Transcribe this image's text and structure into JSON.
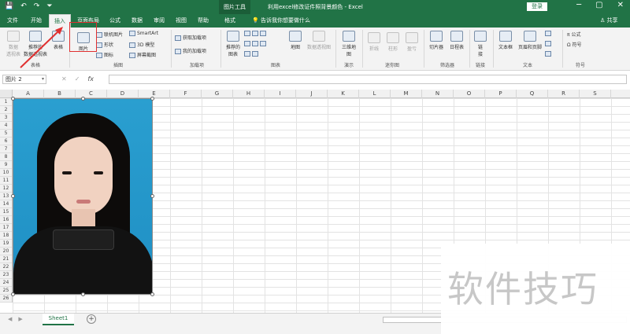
{
  "titlebar": {
    "qat": [
      "💾",
      "↶",
      "↷",
      "⏷"
    ],
    "picture_tools": "图片工具",
    "document_title": "利用excel修改证件照背景颜色  -  Excel",
    "login": "登录",
    "window_controls": [
      "─",
      "▢",
      "✕"
    ]
  },
  "tabs": [
    {
      "label": "文件"
    },
    {
      "label": "开始"
    },
    {
      "label": "插入"
    },
    {
      "label": "页面布局"
    },
    {
      "label": "公式"
    },
    {
      "label": "数据"
    },
    {
      "label": "审阅"
    },
    {
      "label": "视图"
    },
    {
      "label": "帮助"
    },
    {
      "label": "格式"
    }
  ],
  "tell_me": "💡 告诉我你想要做什么",
  "share": "♙ 共享",
  "ribbon": {
    "pivot": "数据\n透视表",
    "recommended_pivot": "推荐的\n数据透视表",
    "table": "表格",
    "group_tables": "表格",
    "picture": "图片",
    "online_picture": "联机图片",
    "shapes": "形状",
    "icons": "图标",
    "smartart": "SmartArt",
    "model3d": "3D 模型",
    "screenshot": "屏幕截图",
    "group_illustrations": "插图",
    "get_addins": "获取加载项",
    "my_addins": "我的加载项",
    "group_addins": "加载项",
    "recommended_charts": "推荐的\n图表",
    "maps": "地图",
    "pivot_chart": "数据透视图",
    "group_charts": "图表",
    "map3d": "三维地\n图",
    "group_tours": "演示",
    "line": "折线",
    "column": "柱形",
    "winloss": "盈亏",
    "group_sparklines": "迷你图",
    "slicer": "切片器",
    "timeline": "日程表",
    "group_filters": "筛选器",
    "link": "链\n接",
    "group_links": "链接",
    "textbox": "文本框",
    "header_footer": "页眉和页脚",
    "group_text": "文本",
    "equation": "π 公式",
    "symbol": "Ω 符号",
    "group_symbols": "符号"
  },
  "formula_bar": {
    "name_box": "图片 2",
    "cancel": "✕",
    "enter": "✓",
    "fx": "fx"
  },
  "columns": [
    "A",
    "B",
    "C",
    "D",
    "E",
    "F",
    "G",
    "H",
    "I",
    "J",
    "K",
    "L",
    "M",
    "N",
    "O",
    "P",
    "Q",
    "R",
    "S"
  ],
  "rows": [
    "1",
    "2",
    "3",
    "4",
    "5",
    "6",
    "7",
    "8",
    "9",
    "10",
    "11",
    "12",
    "13",
    "14",
    "15",
    "16",
    "17",
    "18",
    "19",
    "20",
    "21",
    "22",
    "23",
    "24",
    "25",
    "26"
  ],
  "sheet_tab": "Sheet1",
  "add_sheet": "+",
  "watermark": "软件技巧",
  "colors": {
    "excel_green": "#217346",
    "annotation_red": "#e03030",
    "photo_bg": "#2a9fd0"
  }
}
